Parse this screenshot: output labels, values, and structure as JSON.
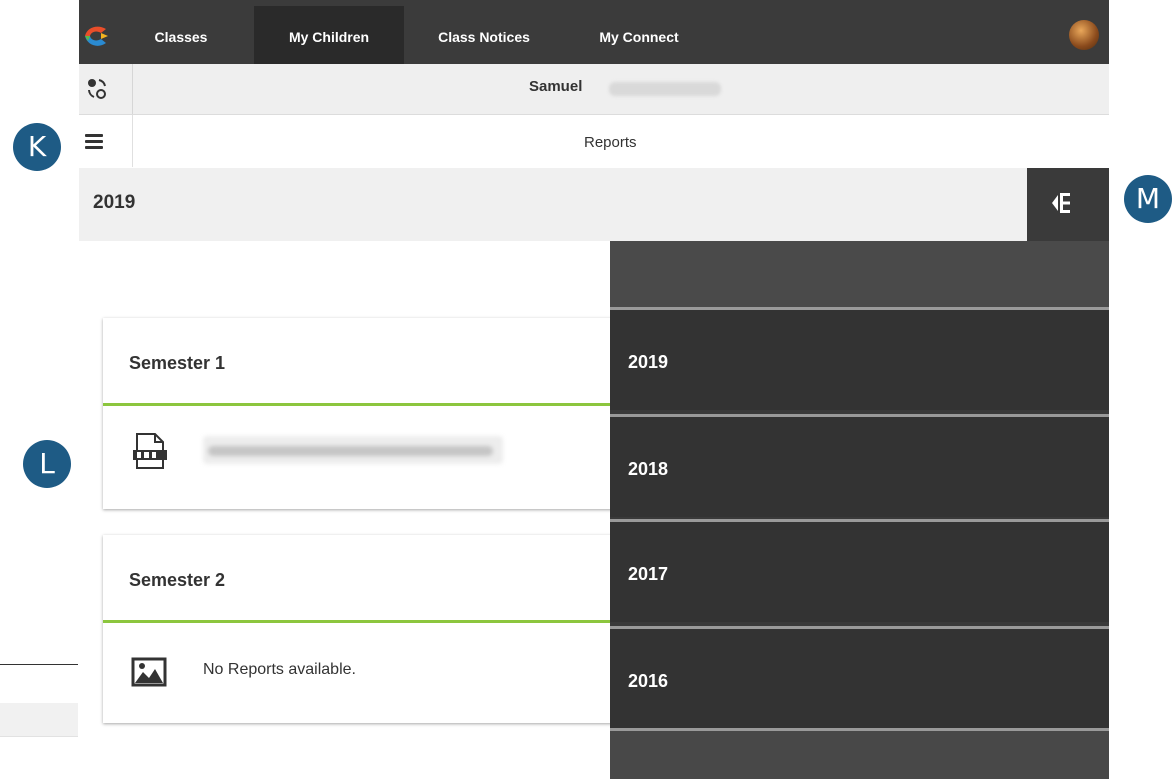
{
  "nav": {
    "tabs": [
      {
        "label": "Classes"
      },
      {
        "label": "My Children"
      },
      {
        "label": "Class Notices"
      },
      {
        "label": "My Connect"
      }
    ],
    "active_tab": "My Children"
  },
  "child": {
    "first_name": "Samuel"
  },
  "page": {
    "title": "Reports"
  },
  "year_header": {
    "title": "2019"
  },
  "semesters": [
    {
      "title": "Semester 1"
    },
    {
      "title": "Semester 2",
      "empty_message": "No Reports available."
    }
  ],
  "year_panel": {
    "years": [
      {
        "label": "2019"
      },
      {
        "label": "2018"
      },
      {
        "label": "2017"
      },
      {
        "label": "2016"
      }
    ]
  },
  "callouts": {
    "k": "K",
    "l": "L",
    "m": "M"
  },
  "colors": {
    "nav_bg": "#3b3b3b",
    "accent_green": "#8cc63e",
    "callout_blue": "#1e5b85",
    "panel_bg": "#333333"
  },
  "icons": {
    "logo": "app-logo",
    "switch_child": "switch-child-icon",
    "menu": "hamburger-menu-icon",
    "panel_toggle": "year-list-toggle-icon",
    "pdf": "pdf-file-icon",
    "image": "image-placeholder-icon"
  }
}
